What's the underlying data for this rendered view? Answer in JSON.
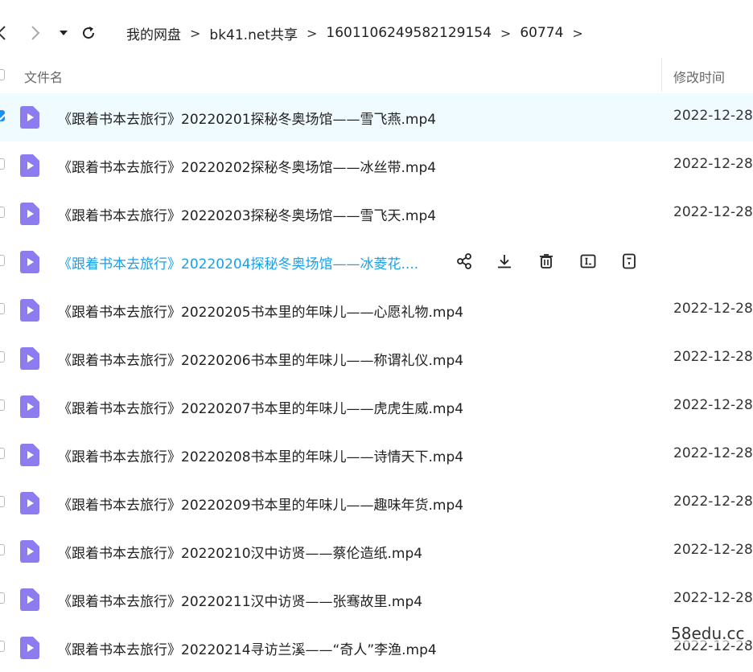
{
  "breadcrumb": [
    {
      "label": "我的网盘"
    },
    {
      "label": "bk41.net共享"
    },
    {
      "label": "1601106249582129154"
    },
    {
      "label": "60774"
    }
  ],
  "breadcrumb_separator": ">",
  "header": {
    "name_label": "文件名",
    "date_label": "修改时间"
  },
  "files": [
    {
      "name": "《跟着书本去旅行》20220201探秘冬奥场馆——雪飞燕.mp4",
      "date": "2022-12-28"
    },
    {
      "name": "《跟着书本去旅行》20220202探秘冬奥场馆——冰丝带.mp4",
      "date": "2022-12-28"
    },
    {
      "name": "《跟着书本去旅行》20220203探秘冬奥场馆——雪飞天.mp4",
      "date": "2022-12-28"
    },
    {
      "name": "《跟着书本去旅行》20220204探秘冬奥场馆——冰菱花....",
      "date": ""
    },
    {
      "name": "《跟着书本去旅行》20220205书本里的年味儿——心愿礼物.mp4",
      "date": "2022-12-28"
    },
    {
      "name": "《跟着书本去旅行》20220206书本里的年味儿——称谓礼仪.mp4",
      "date": "2022-12-28"
    },
    {
      "name": "《跟着书本去旅行》20220207书本里的年味儿——虎虎生威.mp4",
      "date": "2022-12-28"
    },
    {
      "name": "《跟着书本去旅行》20220208书本里的年味儿——诗情天下.mp4",
      "date": "2022-12-28"
    },
    {
      "name": "《跟着书本去旅行》20220209书本里的年味儿——趣味年货.mp4",
      "date": "2022-12-28"
    },
    {
      "name": "《跟着书本去旅行》20220210汉中访贤——蔡伦造纸.mp4",
      "date": "2022-12-28"
    },
    {
      "name": "《跟着书本去旅行》20220211汉中访贤——张骞故里.mp4",
      "date": "2022-12-28"
    },
    {
      "name": "《跟着书本去旅行》20220214寻访兰溪——“奇人”李渔.mp4",
      "date": "2022-12-28"
    }
  ],
  "selected_index": 0,
  "hover_index": 3,
  "row_actions": [
    "share-icon",
    "download-icon",
    "delete-icon",
    "rename-icon",
    "more-icon"
  ],
  "watermark": "58edu.cc",
  "colors": {
    "accent": "#1aa0e8",
    "selected_row": "#f0fbff",
    "file_icon": "#8c7cf0"
  }
}
